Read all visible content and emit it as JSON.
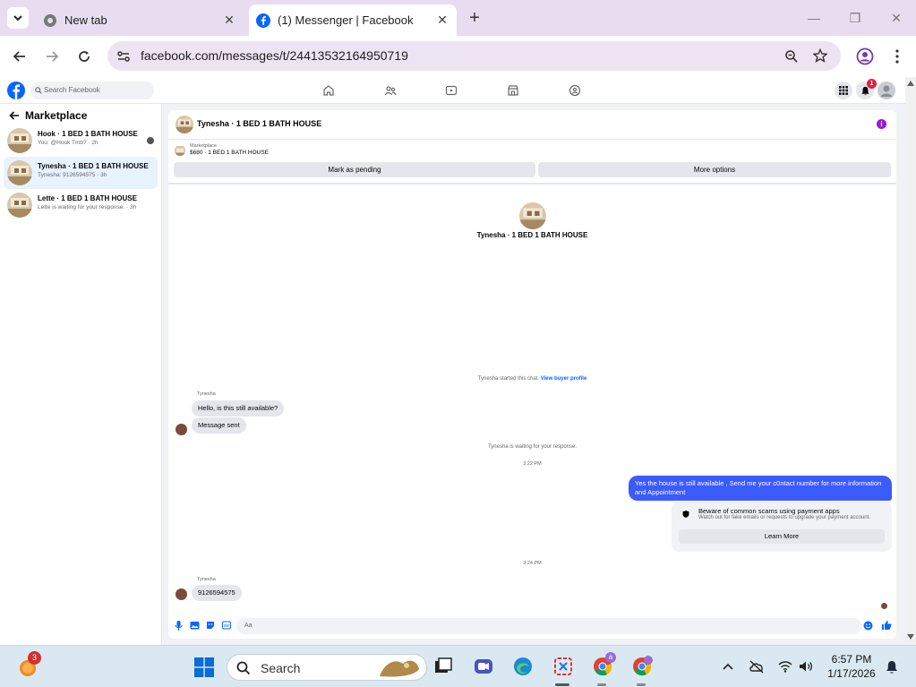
{
  "browser": {
    "tabs": [
      {
        "title": "New tab"
      },
      {
        "title": "(1) Messenger | Facebook"
      }
    ],
    "url": "facebook.com/messages/t/24413532164950719"
  },
  "fb": {
    "search_placeholder": "Search Facebook",
    "notification_count": "1"
  },
  "sidebar": {
    "title": "Marketplace",
    "conversations": [
      {
        "title": "Hook · 1 BED 1 BATH HOUSE",
        "snippet": "You: @Hook Tmb? · 2h"
      },
      {
        "title": "Tynesha · 1 BED 1 BATH HOUSE",
        "snippet": "Tynesha: 9126594575 · 3h"
      },
      {
        "title": "Lette · 1 BED 1 BATH HOUSE",
        "snippet": "Lette is waiting for your response. · 3h"
      }
    ]
  },
  "chat": {
    "header_title": "Tynesha · 1 BED 1 BATH HOUSE",
    "listing_label": "Marketplace",
    "listing_info": "$680 · 1 BED 1 BATH HOUSE",
    "mark_pending": "Mark as pending",
    "more_options": "More options",
    "profile_name": "Tynesha · 1 BED 1 BATH HOUSE",
    "started_text": "Tynesha started this chat.",
    "view_profile": "View buyer profile",
    "sender_label_1": "Tynesha",
    "msg_1": "Hello, is this still available?",
    "msg_2": "Message sent",
    "waiting_text": "Tynesha is waiting for your response.",
    "time_1": "3:22 PM",
    "outgoing": "Yes the house is still available , Send me your c0ntact number for more information and Appointment",
    "scam_title": "Beware of common scams using payment apps",
    "scam_sub": "Watch out for fake emails or requests to upgrade your payment account.",
    "learn_more": "Learn More",
    "time_2": "3:24 PM",
    "sender_label_2": "Tynesha",
    "msg_3": "9126594575",
    "composer_placeholder": "Aa"
  },
  "taskbar": {
    "weather_badge": "3",
    "search_label": "Search",
    "chrome_badge": "a",
    "time": "6:57 PM",
    "date": "1/17/2026"
  },
  "colors": {
    "accent": "#3b5bfc",
    "fb_blue": "#0866ff",
    "tabstrip": "#e8ddf0"
  }
}
